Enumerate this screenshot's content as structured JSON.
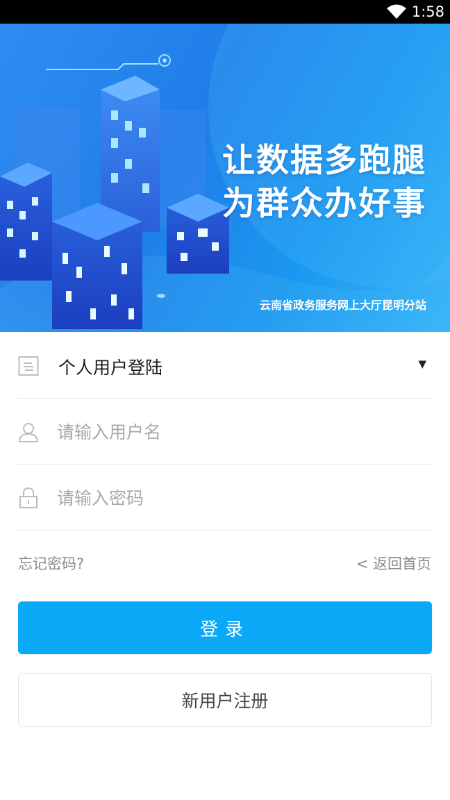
{
  "status_bar": {
    "time": "1:58",
    "wifi_icon": "wifi-icon"
  },
  "banner": {
    "slogan_line1": "让数据多跑腿",
    "slogan_line2": "为群众办好事",
    "subtitle": "云南省政务服务网上大厅昆明分站"
  },
  "login_form": {
    "user_type": {
      "label": "个人用户登陆",
      "icon": "id-card-icon",
      "caret_icon": "caret-down-icon"
    },
    "username": {
      "value": "",
      "placeholder": "请输入用户名",
      "icon": "user-icon"
    },
    "password": {
      "value": "",
      "placeholder": "请输入密码",
      "icon": "lock-icon"
    },
    "forgot_password": "忘记密码?",
    "back_home": "< 返回首页",
    "login_button": "登录",
    "register_button": "新用户注册"
  },
  "colors": {
    "accent": "#0aa8f7",
    "banner_blue": "#1f7ee8",
    "placeholder": "#a9a9a9",
    "link_gray": "#8a8a8a"
  }
}
